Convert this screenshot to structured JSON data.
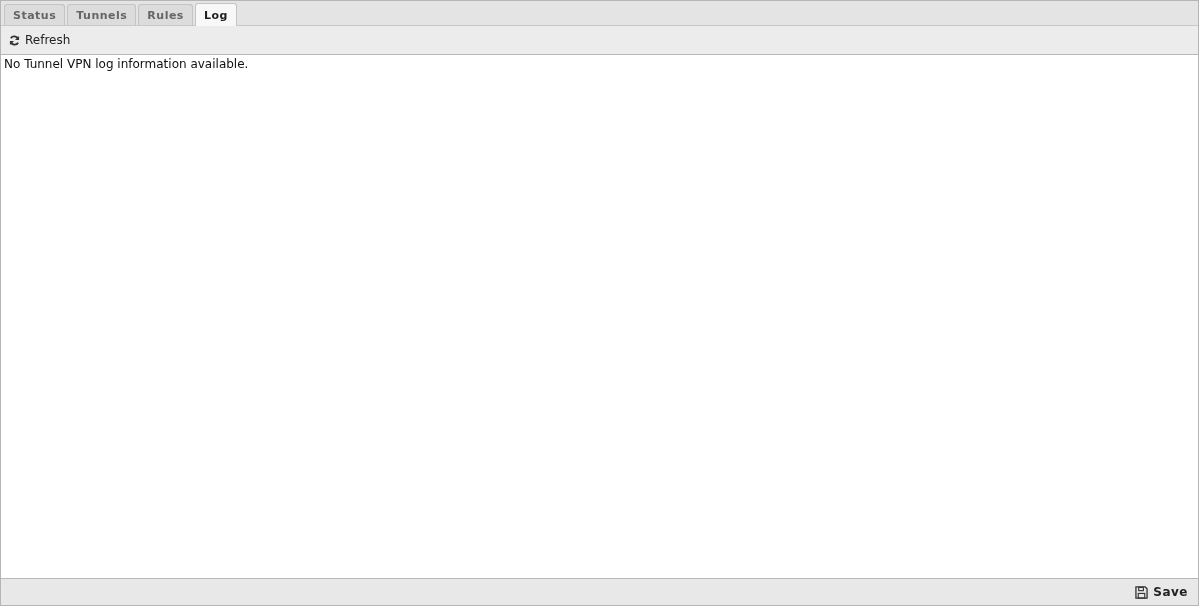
{
  "tabs": [
    {
      "label": "Status",
      "selected": false
    },
    {
      "label": "Tunnels",
      "selected": false
    },
    {
      "label": "Rules",
      "selected": false
    },
    {
      "label": "Log",
      "selected": true
    }
  ],
  "toolbar": {
    "refresh_label": "Refresh"
  },
  "log": {
    "message": "No Tunnel VPN log information available."
  },
  "footer": {
    "save_label": "Save"
  }
}
